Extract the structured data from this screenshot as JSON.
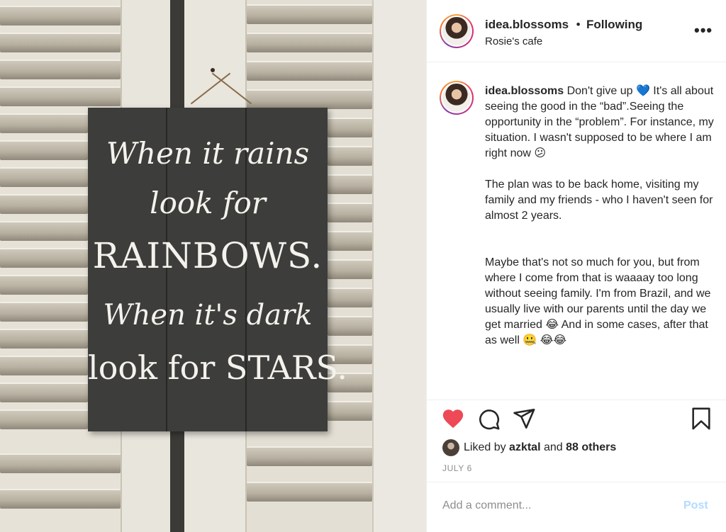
{
  "photo": {
    "sign_lines": [
      "When it rains",
      "look for",
      "RAINBOWS.",
      "When it's dark",
      "look for STARS."
    ]
  },
  "header": {
    "username": "idea.blossoms",
    "separator": "•",
    "follow_status": "Following",
    "location": "Rosie's cafe",
    "more_icon": "•••"
  },
  "caption": {
    "username": "idea.blossoms",
    "text": " Don't give up 💙 It's all about seeing the good in the “bad”.Seeing the opportunity in the “problem”. For instance, my situation. I wasn't supposed to be where I am right now 😕\n\nThe plan was to be back home, visiting my family and my friends - who I haven't seen for almost 2 years.\n\n\nMaybe that's not so much for you, but from where I come from that is waaaay too long without seeing family. I'm from Brazil, and we usually live with our parents until the day we get married 😂 And in some cases, after that as well 🤐 😂😂"
  },
  "likes": {
    "prefix": "Liked by",
    "user": "azktal",
    "conjunction": "and",
    "others": "88 others"
  },
  "date": "JULY 6",
  "comment": {
    "placeholder": "Add a comment...",
    "post_label": "Post"
  },
  "colors": {
    "heart": "#ed4956",
    "post_disabled": "#b3dbff",
    "muted": "#8e8e8e"
  }
}
